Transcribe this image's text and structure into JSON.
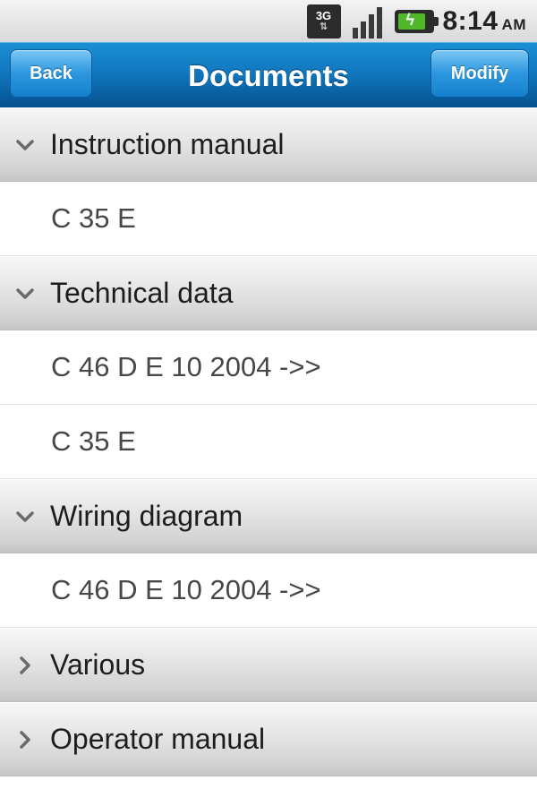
{
  "status_bar": {
    "network_label": "3G",
    "network_arrows": "⇅",
    "time": "8:14",
    "ampm": "AM",
    "icons": [
      "network-3g-icon",
      "signal-icon",
      "battery-icon"
    ]
  },
  "navbar": {
    "title": "Documents",
    "back_label": "Back",
    "modify_label": "Modify",
    "accent_color": "#1178bf"
  },
  "sections": [
    {
      "label": "Instruction manual",
      "expanded": true,
      "items": [
        "C 35 E"
      ]
    },
    {
      "label": "Technical data",
      "expanded": true,
      "items": [
        "C 46 D E 10 2004 ->>",
        "C 35 E"
      ]
    },
    {
      "label": "Wiring diagram",
      "expanded": true,
      "items": [
        "C 46 D E 10 2004 ->>"
      ]
    },
    {
      "label": "Various",
      "expanded": false,
      "items": []
    },
    {
      "label": "Operator manual",
      "expanded": false,
      "items": []
    }
  ]
}
